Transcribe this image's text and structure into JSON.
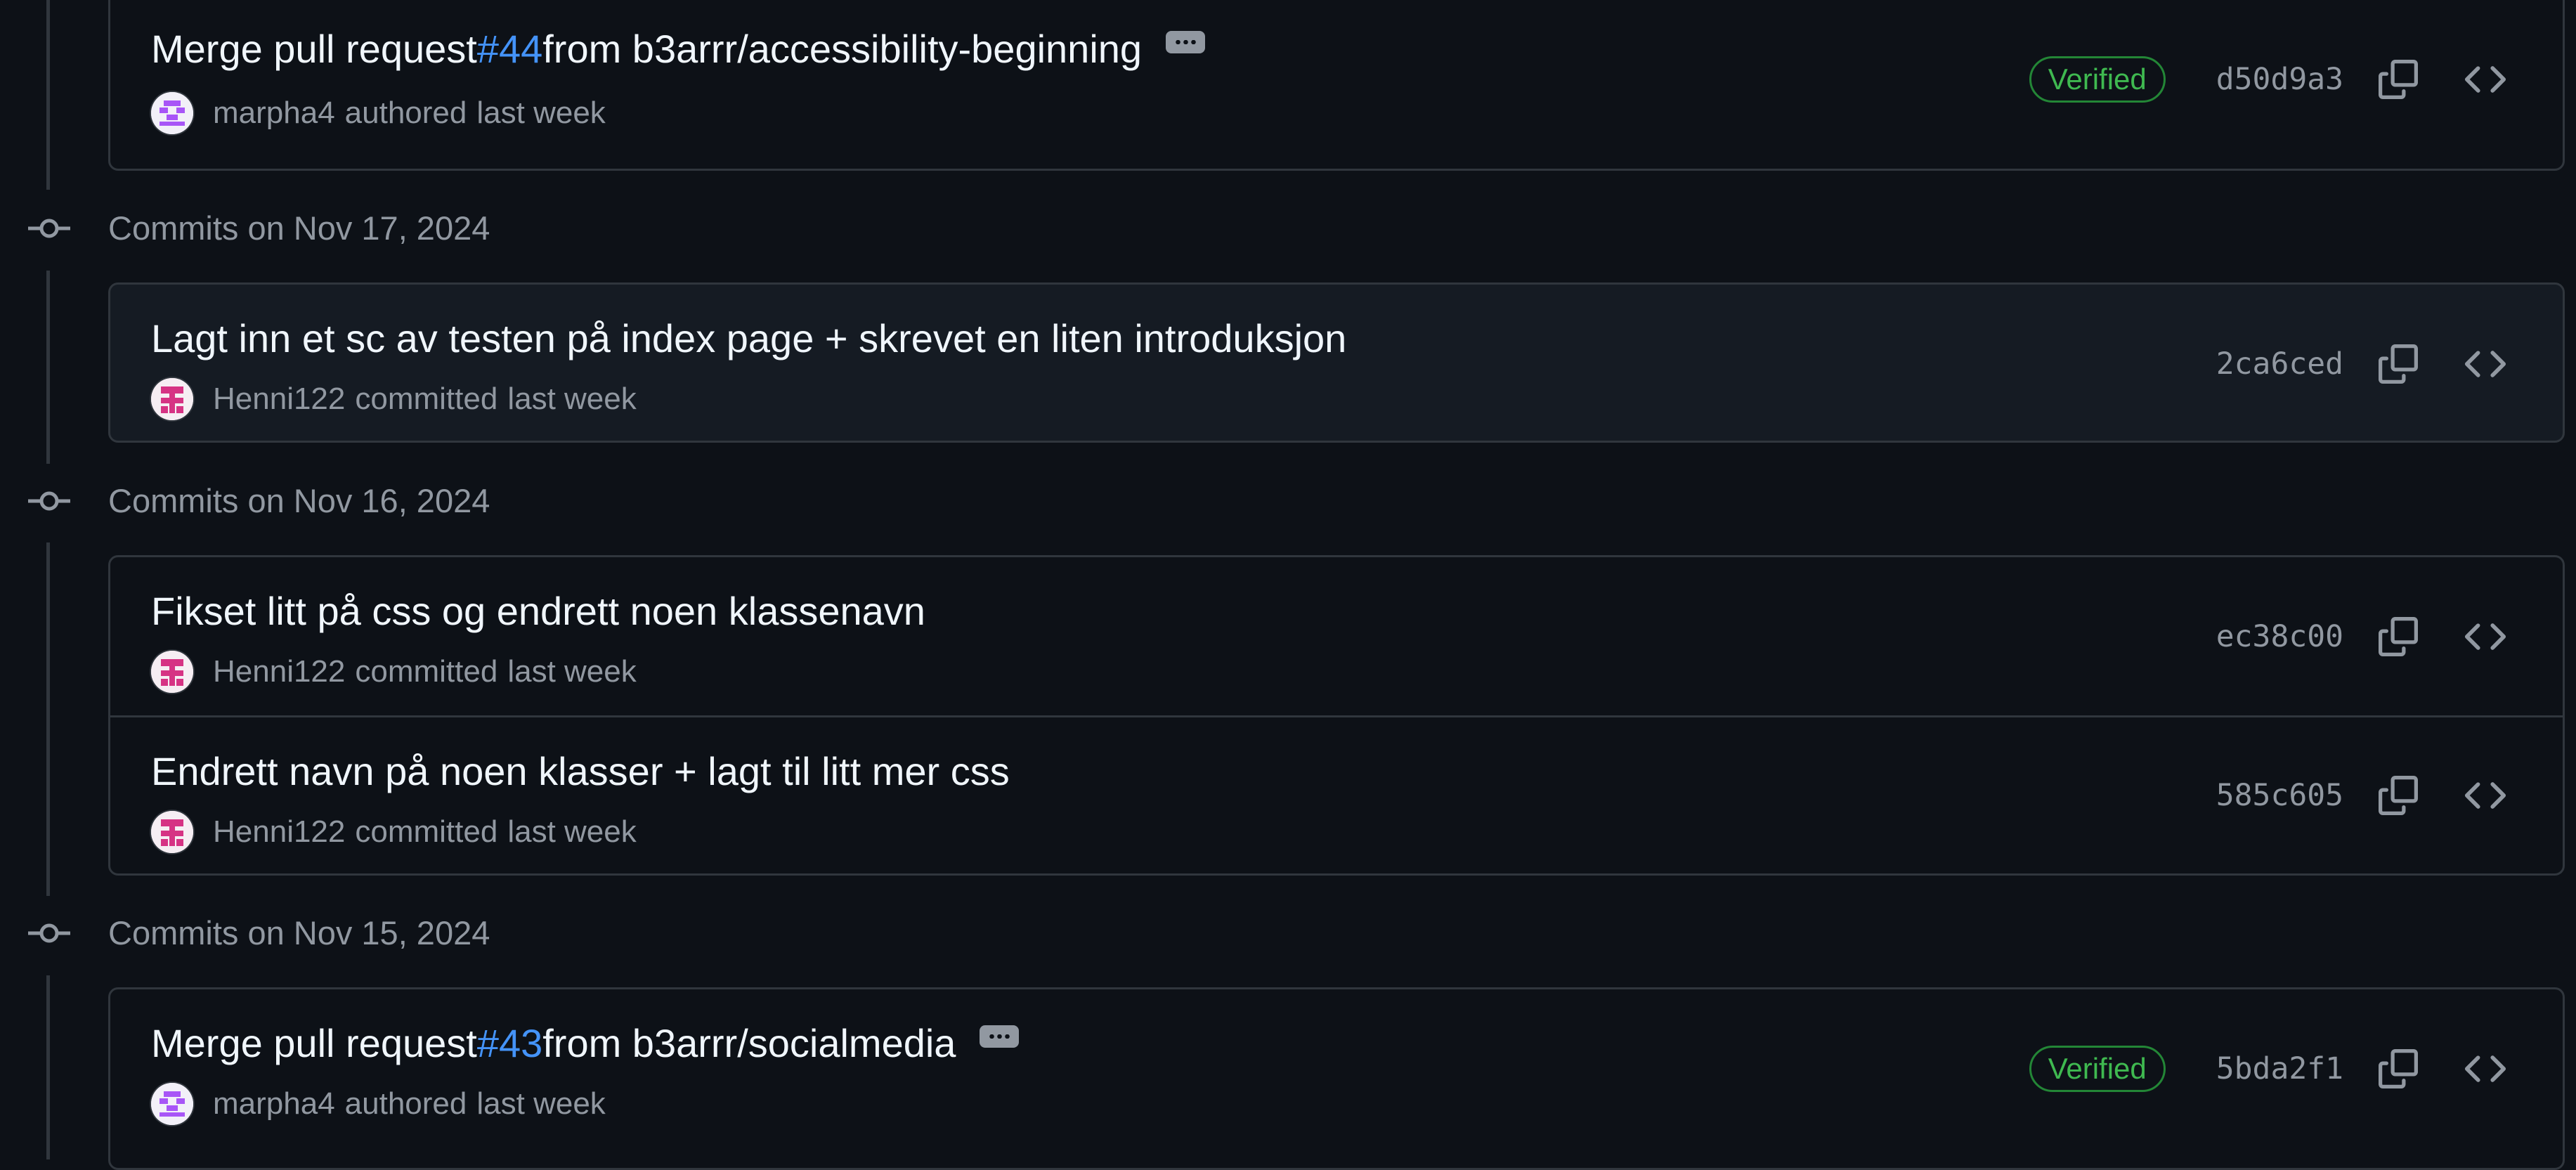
{
  "groups": [
    {
      "title": "",
      "commits": [
        {
          "msg_prefix": "Merge pull request ",
          "pr": "#44",
          "msg_suffix": " from b3arrr/accessibility-beginning",
          "author": "marpha4",
          "action": "authored",
          "when": "last week",
          "verified": "Verified",
          "sha": "d50d9a3"
        }
      ]
    },
    {
      "title": "Commits on Nov 17, 2024",
      "commits": [
        {
          "msg": "Lagt inn et sc av testen på index page + skrevet en liten introduksjon",
          "author": "Henni122",
          "action": "committed",
          "when": "last week",
          "sha": "2ca6ced"
        }
      ]
    },
    {
      "title": "Commits on Nov 16, 2024",
      "commits": [
        {
          "msg": "Fikset litt på css og endrett noen klassenavn",
          "author": "Henni122",
          "action": "committed",
          "when": "last week",
          "sha": "ec38c00"
        },
        {
          "msg": "Endrett navn på noen klasser + lagt til litt mer css",
          "author": "Henni122",
          "action": "committed",
          "when": "last week",
          "sha": "585c605"
        }
      ]
    },
    {
      "title": "Commits on Nov 15, 2024",
      "commits": [
        {
          "msg_prefix": "Merge pull request ",
          "pr": "#43",
          "msg_suffix": " from b3arrr/socialmedia",
          "author": "marpha4",
          "action": "authored",
          "when": "last week",
          "verified": "Verified",
          "sha": "5bda2f1"
        }
      ]
    }
  ],
  "icons": {
    "copy": "copy-icon",
    "browse": "code-icon",
    "node": "git-commit-icon",
    "more": "ellipsis-icon"
  },
  "colors": {
    "bg": "#0d1117",
    "border": "#30363d",
    "link": "#4493f8",
    "verified": "#3fb950",
    "muted": "#9198a1"
  }
}
